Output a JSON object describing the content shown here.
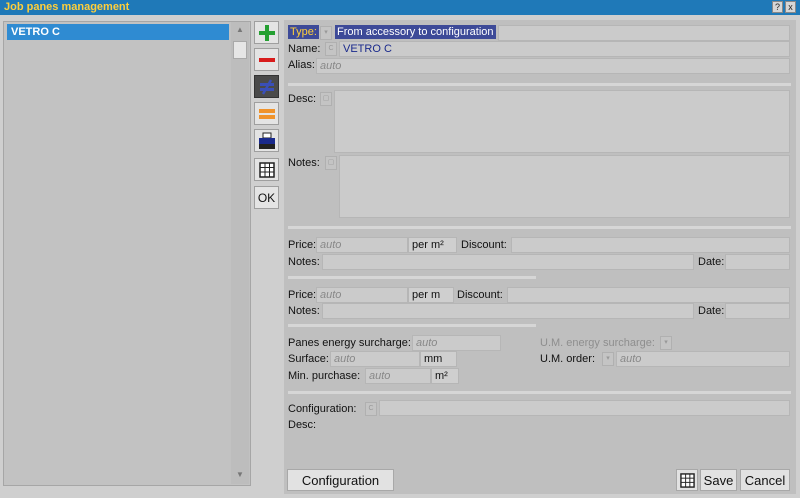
{
  "window": {
    "title": "Job panes management",
    "help_label": "?",
    "close_label": "x"
  },
  "list": {
    "items": [
      "VETRO C"
    ],
    "scroll_up": "▲",
    "scroll_down": "▼"
  },
  "toolbar": {
    "ok_label": "OK"
  },
  "form": {
    "type_label": "Type:",
    "type_value": "From accessory to configuration",
    "name_label": "Name:",
    "name_value": "VETRO C",
    "alias_label": "Alias:",
    "alias_placeholder": "auto",
    "desc_label": "Desc:",
    "notes_label": "Notes:",
    "price1": {
      "price_label": "Price:",
      "price_placeholder": "auto",
      "unit": "per m²",
      "discount_label": "Discount:",
      "notes_label": "Notes:",
      "date_label": "Date:"
    },
    "price2": {
      "price_label": "Price:",
      "price_placeholder": "auto",
      "unit": "per m",
      "discount_label": "Discount:",
      "notes_label": "Notes:",
      "date_label": "Date:"
    },
    "energy_label": "Panes energy surcharge:",
    "energy_placeholder": "auto",
    "um_energy_label": "U.M. energy surcharge:",
    "surface_label": "Surface:",
    "surface_placeholder": "auto",
    "surface_unit": "mm",
    "um_order_label": "U.M. order:",
    "um_order_placeholder": "auto",
    "min_purchase_label": "Min. purchase:",
    "min_purchase_placeholder": "auto",
    "min_purchase_unit": "m²",
    "configuration_label": "Configuration:",
    "configuration_prefix": "C",
    "config_desc_label": "Desc:"
  },
  "footer": {
    "configuration_button": "Configuration",
    "save_button": "Save",
    "cancel_button": "Cancel"
  },
  "colors": {
    "titlebar": "#1f79b8",
    "title_text": "#ffcf3a",
    "selection": "#2f8bd2",
    "type_highlight": "#3d4a98",
    "add_icon": "#25a032",
    "remove_icon": "#d81c1c",
    "duplicate_icon": "#f0932b"
  }
}
